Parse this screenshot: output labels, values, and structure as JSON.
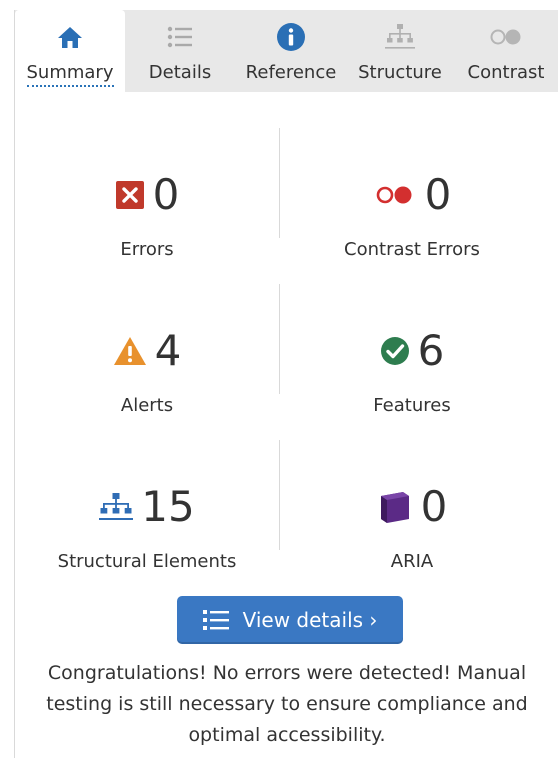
{
  "tabs": [
    {
      "label": "Summary",
      "icon": "home-icon",
      "active": true
    },
    {
      "label": "Details",
      "icon": "list-icon",
      "active": false
    },
    {
      "label": "Reference",
      "icon": "info-icon",
      "active": false
    },
    {
      "label": "Structure",
      "icon": "hierarchy-icon",
      "active": false
    },
    {
      "label": "Contrast",
      "icon": "contrast-icon",
      "active": false
    }
  ],
  "stats": {
    "errors": {
      "count": "0",
      "label": "Errors",
      "icon": "error-x-icon",
      "color": "#c0392b"
    },
    "contrast_errors": {
      "count": "0",
      "label": "Contrast Errors",
      "icon": "contrast-error-icon",
      "color": "#d32f2f"
    },
    "alerts": {
      "count": "4",
      "label": "Alerts",
      "icon": "alert-triangle-icon",
      "color": "#e8912d"
    },
    "features": {
      "count": "6",
      "label": "Features",
      "icon": "check-circle-icon",
      "color": "#2e7d4f"
    },
    "structural": {
      "count": "15",
      "label": "Structural Elements",
      "icon": "structure-icon",
      "color": "#2f6db5"
    },
    "aria": {
      "count": "0",
      "label": "ARIA",
      "icon": "aria-cube-icon",
      "color": "#5b2a86"
    }
  },
  "button": {
    "label": "View details ›",
    "icon": "list-icon"
  },
  "message": "Congratulations! No errors were detected! Manual testing is still necessary to ensure compliance and optimal accessibility.",
  "colors": {
    "accent": "#3a78c3",
    "tab_bar": "#e8e8e8"
  }
}
